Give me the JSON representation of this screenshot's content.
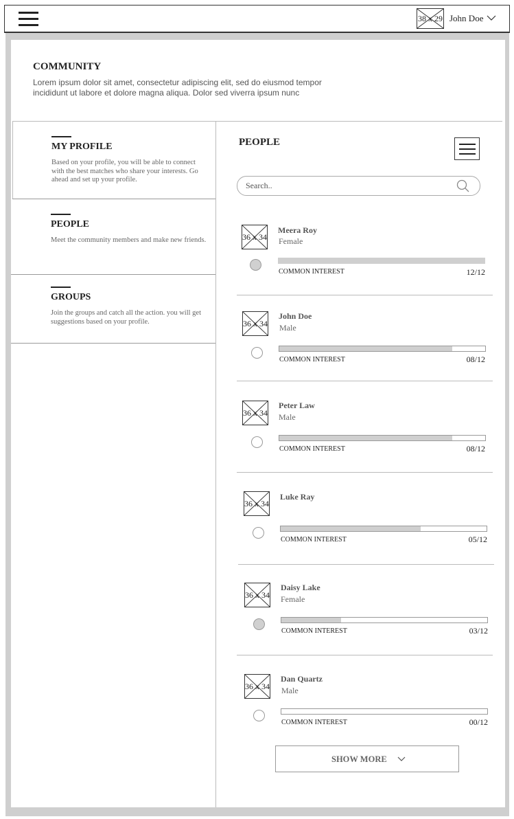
{
  "header": {
    "avatar_placeholder": "38 x 29",
    "user_name": "John Doe",
    "menu_icon": "hamburger-icon",
    "dropdown_icon": "chevron-down-icon"
  },
  "community": {
    "title": "COMMUNITY",
    "description": "Lorem ipsum dolor sit amet, consectetur adipiscing elit, sed do eiusmod tempor incididunt ut labore et dolore magna aliqua. Dolor sed viverra ipsum nunc"
  },
  "sidebar": {
    "items": [
      {
        "title": "MY PROFILE",
        "description": "Based on your profile, you will  be able to connect with the best matches who share your interests. Go ahead and set up your profile."
      },
      {
        "title": "PEOPLE",
        "description": "Meet the community members and make new friends."
      },
      {
        "title": "GROUPS",
        "description": "Join the groups and catch all the action. you will get suggestions based on your profile."
      }
    ]
  },
  "people_panel": {
    "title": "PEOPLE",
    "search_placeholder": "Search..",
    "common_interest_label": "COMMON INTEREST",
    "avatar_placeholder": "36 x 34",
    "show_more_label": "SHOW MORE",
    "people": [
      {
        "name": "Meera Roy",
        "gender": "Female",
        "score": "12/12",
        "progress": 1.0,
        "selected": true
      },
      {
        "name": "John Doe",
        "gender": "Male",
        "score": "08/12",
        "progress": 0.84,
        "selected": false
      },
      {
        "name": "Peter Law",
        "gender": "Male",
        "score": "08/12",
        "progress": 0.84,
        "selected": false
      },
      {
        "name": "Luke Ray",
        "gender": "",
        "score": "05/12",
        "progress": 0.68,
        "selected": false
      },
      {
        "name": "Daisy Lake",
        "gender": "Female",
        "score": "03/12",
        "progress": 0.29,
        "selected": true
      },
      {
        "name": "Dan Quartz",
        "gender": "Male",
        "score": "00/12",
        "progress": 0.0,
        "selected": false
      }
    ]
  }
}
